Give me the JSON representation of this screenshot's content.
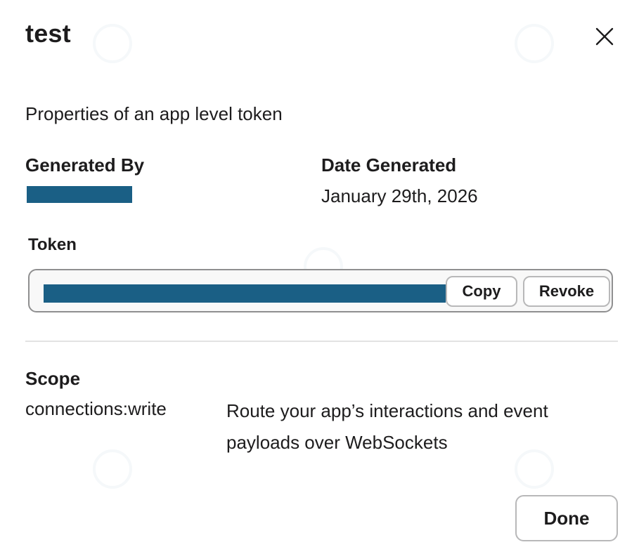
{
  "dialog": {
    "title": "test",
    "subtitle": "Properties of an app level token",
    "close_icon": "close-icon"
  },
  "meta": {
    "generated_by_label": "Generated By",
    "generated_by_value": "",
    "date_generated_label": "Date Generated",
    "date_generated_value": "January 29th, 2026"
  },
  "token": {
    "label": "Token",
    "value": "",
    "copy_label": "Copy",
    "revoke_label": "Revoke"
  },
  "scope": {
    "label": "Scope",
    "items": [
      {
        "name": "connections:write",
        "description": "Route your app’s interactions and event payloads over WebSockets"
      }
    ]
  },
  "footer": {
    "done_label": "Done"
  },
  "colors": {
    "redaction": "#1a5f85",
    "text": "#1d1c1d",
    "border": "#b8b8b9"
  }
}
